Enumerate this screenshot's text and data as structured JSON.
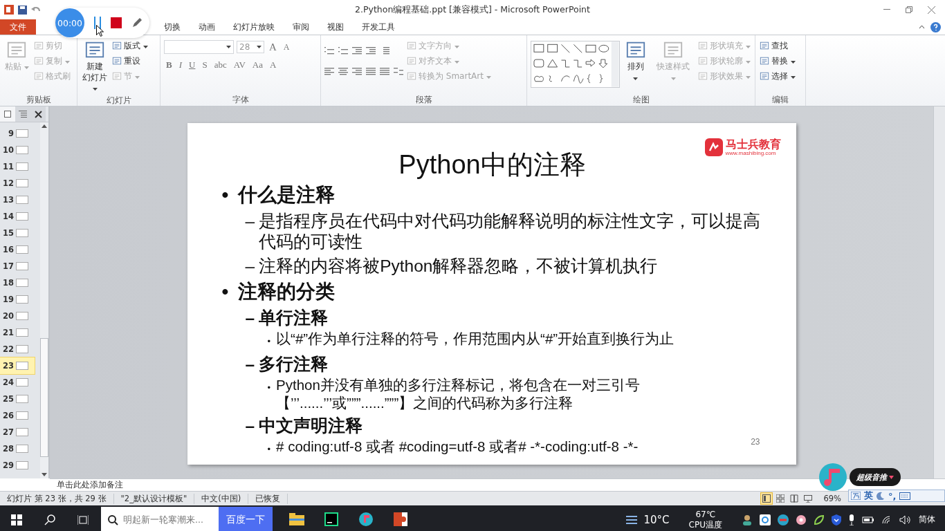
{
  "window": {
    "title": "2.Python编程基础.ppt [兼容模式]  -  Microsoft PowerPoint"
  },
  "recorder": {
    "time": "00:00"
  },
  "tabs": [
    {
      "label": "文件",
      "kind": "file",
      "selected": false
    },
    {
      "label": "切换",
      "kind": "tab",
      "selected": false
    },
    {
      "label": "动画",
      "kind": "tab",
      "selected": false
    },
    {
      "label": "幻灯片放映",
      "kind": "tab",
      "selected": false
    },
    {
      "label": "审阅",
      "kind": "tab",
      "selected": false
    },
    {
      "label": "视图",
      "kind": "tab",
      "selected": false
    },
    {
      "label": "开发工具",
      "kind": "tab",
      "selected": false
    }
  ],
  "ribbon": [
    {
      "kind": "clipboard",
      "label": "剪贴板",
      "items": [
        {
          "kind": "large",
          "label": "粘贴",
          "disabled": true,
          "dropdown": true
        },
        {
          "kind": "small",
          "label": "剪切",
          "disabled": true,
          "dropdown": false
        },
        {
          "kind": "small",
          "label": "复制",
          "disabled": true,
          "dropdown": true
        },
        {
          "kind": "small",
          "label": "格式刷",
          "disabled": true,
          "dropdown": false
        }
      ]
    },
    {
      "kind": "slides",
      "label": "幻灯片",
      "items": [
        {
          "kind": "large",
          "label": [
            "新建",
            "幻灯片"
          ],
          "disabled": false,
          "dropdown": true
        },
        {
          "kind": "small",
          "label": "版式",
          "disabled": false,
          "dropdown": true
        },
        {
          "kind": "small",
          "label": "重设",
          "disabled": false,
          "dropdown": false
        },
        {
          "kind": "small",
          "label": "节",
          "disabled": true,
          "dropdown": true
        }
      ]
    },
    {
      "kind": "font",
      "label": "字体",
      "font_size": "28",
      "size_buttons": [
        "A",
        "A"
      ],
      "buttons": [
        "B",
        "I",
        "U",
        "S",
        "abc",
        "AV",
        "Aa",
        "A"
      ]
    },
    {
      "kind": "paragraph",
      "label": "段落",
      "items": [
        {
          "kind": "small",
          "label": "文字方向",
          "disabled": true,
          "dropdown": true
        },
        {
          "kind": "small",
          "label": "对齐文本",
          "disabled": true,
          "dropdown": true
        },
        {
          "kind": "small",
          "label": "转换为 SmartArt",
          "disabled": true,
          "dropdown": true
        }
      ]
    },
    {
      "kind": "drawing",
      "label": "绘图",
      "items": [
        {
          "kind": "large",
          "label": "排列",
          "disabled": false,
          "dropdown": true
        },
        {
          "kind": "large",
          "label": "快速样式",
          "disabled": true,
          "dropdown": true
        },
        {
          "kind": "small",
          "label": "形状填充",
          "disabled": true,
          "dropdown": true
        },
        {
          "kind": "small",
          "label": "形状轮廓",
          "disabled": true,
          "dropdown": true
        },
        {
          "kind": "small",
          "label": "形状效果",
          "disabled": true,
          "dropdown": true
        }
      ]
    },
    {
      "kind": "editing",
      "label": "编辑",
      "items": [
        {
          "kind": "small",
          "label": "查找",
          "disabled": false,
          "dropdown": false
        },
        {
          "kind": "small",
          "label": "替换",
          "disabled": false,
          "dropdown": true
        },
        {
          "kind": "small",
          "label": "选择",
          "disabled": false,
          "dropdown": true
        }
      ]
    }
  ],
  "slide_panel": {
    "slides": [
      {
        "number": "9",
        "selected": false
      },
      {
        "number": "10",
        "selected": false
      },
      {
        "number": "11",
        "selected": false
      },
      {
        "number": "12",
        "selected": false
      },
      {
        "number": "13",
        "selected": false
      },
      {
        "number": "14",
        "selected": false
      },
      {
        "number": "15",
        "selected": false
      },
      {
        "number": "16",
        "selected": false
      },
      {
        "number": "17",
        "selected": false
      },
      {
        "number": "18",
        "selected": false
      },
      {
        "number": "19",
        "selected": false
      },
      {
        "number": "20",
        "selected": false
      },
      {
        "number": "21",
        "selected": false
      },
      {
        "number": "22",
        "selected": false
      },
      {
        "number": "23",
        "selected": true
      },
      {
        "number": "24",
        "selected": false
      },
      {
        "number": "25",
        "selected": false
      },
      {
        "number": "26",
        "selected": false
      },
      {
        "number": "27",
        "selected": false
      },
      {
        "number": "28",
        "selected": false
      },
      {
        "number": "29",
        "selected": false
      }
    ]
  },
  "slide": {
    "title": "Python中的注释",
    "logo_name": "马士兵教育",
    "logo_url": "www.mashibing.com",
    "page_number": "23",
    "bullets": [
      {
        "marker": "•",
        "text": "什么是注释",
        "children": [
          {
            "marker": "–",
            "text": "是指程序员在代码中对代码功能解释说明的标注性文字，可以提高代码的可读性"
          },
          {
            "marker": "–",
            "text": "注释的内容将被Python解释器忽略，不被计算机执行"
          }
        ]
      },
      {
        "marker": "•",
        "text": "注释的分类",
        "children": [
          {
            "marker": "–",
            "text": "单行注释",
            "children": [
              {
                "marker": "•",
                "text": "以“#”作为单行注释的符号，作用范围内从“#”开始直到换行为止"
              }
            ]
          },
          {
            "marker": "–",
            "text": "多行注释",
            "children": [
              {
                "marker": "•",
                "text": "Python并没有单独的多行注释标记，将包含在一对三引号【’’’......’’’或”””......”””】之间的代码称为多行注释"
              }
            ]
          },
          {
            "marker": "–",
            "text": "中文声明注释",
            "children": [
              {
                "marker": "•",
                "text": "# coding:utf-8  或者 #coding=utf-8  或者# -*-coding:utf-8 -*-"
              }
            ]
          }
        ]
      }
    ]
  },
  "notes": {
    "placeholder": "单击此处添加备注"
  },
  "status_bar": {
    "items": [
      "幻灯片 第 23 张，共 29 张",
      "\"2_默认设计模板\"",
      "中文(中国)",
      "已恢复"
    ],
    "views": [
      {
        "kind": "normal",
        "selected": true
      },
      {
        "kind": "sorter",
        "selected": false
      },
      {
        "kind": "reading",
        "selected": false
      },
      {
        "kind": "show",
        "selected": false
      }
    ],
    "zoom": "69%"
  },
  "music_widget": {
    "label": "超级音推"
  },
  "ime_bar": {
    "mode": "英",
    "punct": "°,"
  },
  "taskbar": {
    "search": {
      "placeholder": "明起新一轮寒潮来..."
    },
    "search_button": "百度一下",
    "apps": [
      {
        "kind": "folder"
      },
      {
        "kind": "ide"
      },
      {
        "kind": "music"
      },
      {
        "kind": "slides"
      }
    ],
    "weather": "10°C",
    "cpu_temp": "67℃",
    "cpu_label": "CPU温度",
    "ime": "简体"
  }
}
